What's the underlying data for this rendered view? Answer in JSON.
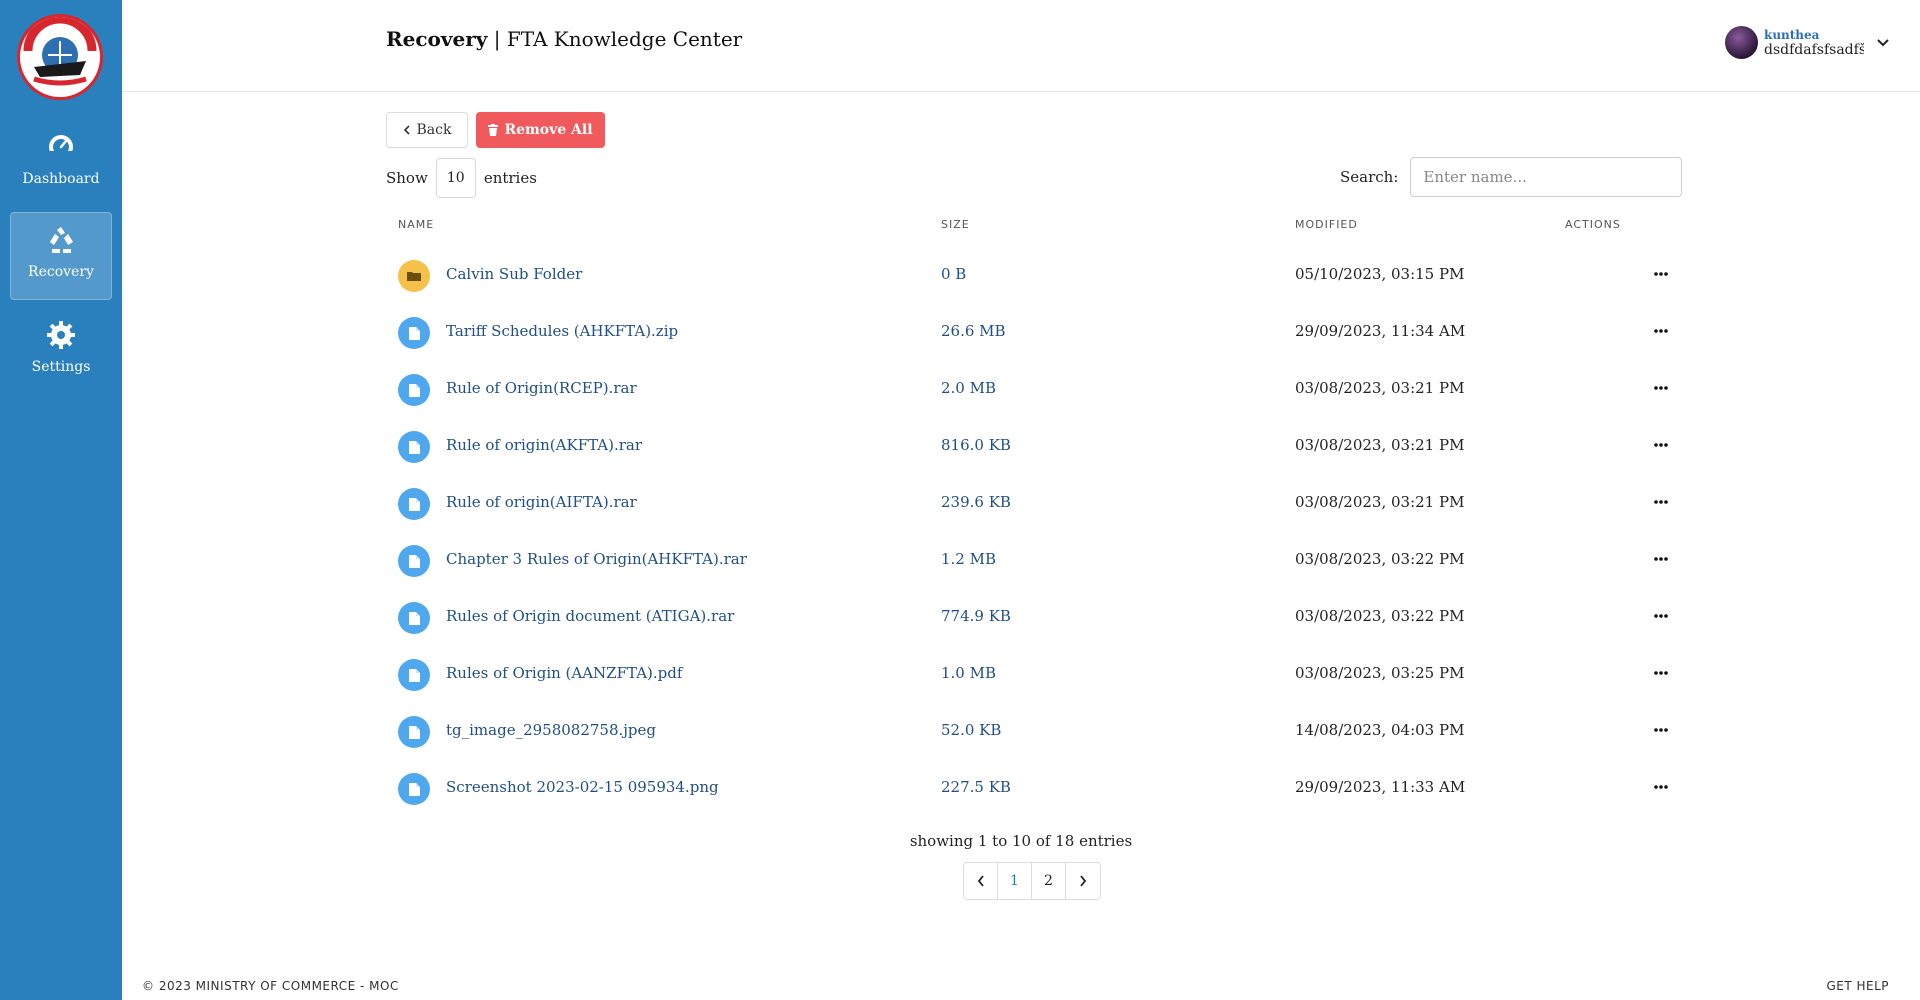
{
  "sidebar": {
    "logo_icon": "ministry-of-commerce-logo",
    "items": [
      {
        "label": "Dashboard",
        "icon": "dashboard-gauge-icon"
      },
      {
        "label": "Recovery",
        "icon": "recycle-icon",
        "active": true
      },
      {
        "label": "Settings",
        "icon": "gear-icon"
      }
    ]
  },
  "header": {
    "title_bold": "Recovery",
    "title_rest": " | FTA Knowledge Center",
    "user_name": "kunthea",
    "user_sub": "dsdfdafsfsadfš",
    "chevron_icon": "chevron-down-icon"
  },
  "toolbar": {
    "back_label": "Back",
    "remove_all_label": "Remove All",
    "show_label": "Show",
    "entries_value": "10",
    "entries_label": "entries",
    "search_label": "Search:",
    "search_placeholder": "Enter name..."
  },
  "table": {
    "headers": {
      "name": "NAME",
      "size": "SIZE",
      "modified": "MODIFIED",
      "actions": "ACTIONS"
    },
    "rows": [
      {
        "type": "folder",
        "name": "Calvin Sub Folder",
        "size": "0 B",
        "modified": "05/10/2023, 03:15 PM"
      },
      {
        "type": "file",
        "name": "Tariff Schedules (AHKFTA).zip",
        "size": "26.6 MB",
        "modified": "29/09/2023, 11:34 AM"
      },
      {
        "type": "file",
        "name": "Rule of Origin(RCEP).rar",
        "size": "2.0 MB",
        "modified": "03/08/2023, 03:21 PM"
      },
      {
        "type": "file",
        "name": "Rule of origin(AKFTA).rar",
        "size": "816.0 KB",
        "modified": "03/08/2023, 03:21 PM"
      },
      {
        "type": "file",
        "name": "Rule of origin(AIFTA).rar",
        "size": "239.6 KB",
        "modified": "03/08/2023, 03:21 PM"
      },
      {
        "type": "file",
        "name": "Chapter 3 Rules of Origin(AHKFTA).rar",
        "size": "1.2 MB",
        "modified": "03/08/2023, 03:22 PM"
      },
      {
        "type": "file",
        "name": "Rules of Origin document (ATIGA).rar",
        "size": "774.9 KB",
        "modified": "03/08/2023, 03:22 PM"
      },
      {
        "type": "file",
        "name": "Rules of Origin (AANZFTA).pdf",
        "size": "1.0 MB",
        "modified": "03/08/2023, 03:25 PM"
      },
      {
        "type": "file",
        "name": "tg_image_2958082758.jpeg",
        "size": "52.0 KB",
        "modified": "14/08/2023, 04:03 PM"
      },
      {
        "type": "file",
        "name": "Screenshot 2023-02-15 095934.png",
        "size": "227.5 KB",
        "modified": "29/09/2023, 11:33 AM"
      }
    ]
  },
  "pagination": {
    "showing_text": "showing 1 to 10 of 18 entries",
    "pages": [
      "1",
      "2"
    ],
    "current_page": "1"
  },
  "footer": {
    "copyright": "© 2023 MINISTRY OF COMMERCE - MOC",
    "help": "GET HELP"
  },
  "colors": {
    "sidebar": "#2a7fbd",
    "danger": "#f05a5d",
    "folder": "#f6c14b",
    "file": "#4fa8ee",
    "link": "#1f4f86"
  }
}
